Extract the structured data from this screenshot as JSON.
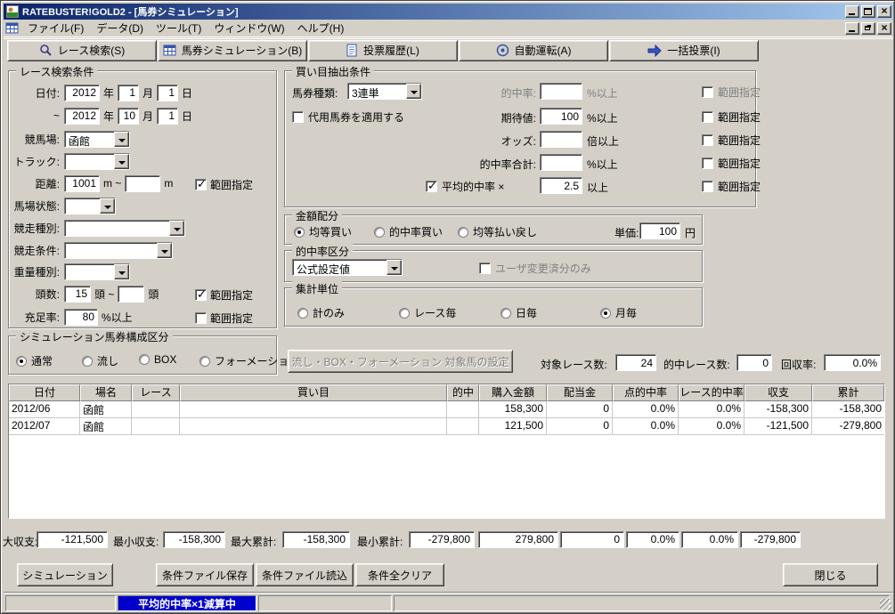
{
  "window": {
    "title": "RATEBUSTER!GOLD2 - [馬券シミュレーション]"
  },
  "menu": {
    "items": [
      "ファイル(F)",
      "データ(D)",
      "ツール(T)",
      "ウィンドウ(W)",
      "ヘルプ(H)"
    ]
  },
  "toolbar": {
    "buttons": [
      {
        "label": "レース検索(S)",
        "icon": "search-icon"
      },
      {
        "label": "馬券シミュレーション(B)",
        "icon": "grid-icon"
      },
      {
        "label": "投票履歴(L)",
        "icon": "document-icon"
      },
      {
        "label": "自動運転(A)",
        "icon": "auto-run-icon"
      },
      {
        "label": "一括投票(I)",
        "icon": "arrow-right-icon"
      }
    ]
  },
  "race_search": {
    "legend": "レース検索条件",
    "date_label": "日付:",
    "tilde": "~",
    "year_unit": "年",
    "month_unit": "月",
    "day_unit": "日",
    "from_year": "2012",
    "from_month": "1",
    "from_day": "1",
    "to_year": "2012",
    "to_month": "10",
    "to_day": "1",
    "course_label": "競馬場:",
    "course_value": "函館",
    "track_label": "トラック:",
    "track_value": "",
    "distance_label": "距離:",
    "distance_from": "1001",
    "distance_mid": "m ~",
    "distance_to": "",
    "distance_unit": "m",
    "range_label": "範囲指定",
    "distance_range_checked": true,
    "baba_label": "馬場状態:",
    "baba_value": "",
    "type_label": "競走種別:",
    "type_value": "",
    "cond_label": "競走条件:",
    "cond_value": "",
    "weight_label": "重量種別:",
    "weight_value": "",
    "heads_label": "頭数:",
    "heads_from": "15",
    "heads_mid": "頭 ~",
    "heads_to": "",
    "heads_unit": "頭",
    "heads_range_checked": true,
    "fill_label": "充足率:",
    "fill_value": "80",
    "fill_unit": "%以上",
    "fill_range_checked": false
  },
  "bet_extract": {
    "legend": "買い目抽出条件",
    "ticket_label": "馬券種類:",
    "ticket_value": "3連単",
    "substitute_label": "代用馬券を適用する",
    "substitute_checked": false,
    "range_label": "範囲指定",
    "hit_label": "的中率:",
    "hit_value": "",
    "hit_unit": "%以上",
    "hit_disabled": true,
    "expect_label": "期待値:",
    "expect_value": "100",
    "expect_unit": "%以上",
    "odds_label": "オッズ:",
    "odds_value": "",
    "odds_unit": "倍以上",
    "hit_total_label": "的中率合計:",
    "hit_total_value": "",
    "hit_total_unit": "%以上",
    "avg_label": "平均的中率 ×",
    "avg_value": "2.5",
    "avg_unit": "以上",
    "avg_checked": true
  },
  "amount": {
    "legend": "金額配分",
    "opt1": "均等買い",
    "opt2": "的中率買い",
    "opt3": "均等払い戻し",
    "selected_index": 0,
    "price_label": "単価:",
    "price_value": "100",
    "price_unit": "円"
  },
  "hit_class": {
    "legend": "的中率区分",
    "value": "公式設定値",
    "user_label": "ユーザ変更済分のみ",
    "user_checked": false
  },
  "aggregate": {
    "legend": "集計単位",
    "opt1": "計のみ",
    "opt2": "レース毎",
    "opt3": "日毎",
    "opt4": "月毎",
    "selected_index": 3
  },
  "sim_comp": {
    "legend": "シミュレーション馬券構成区分",
    "opt1": "通常",
    "opt2": "流し",
    "opt3": "BOX",
    "opt4": "フォーメーション",
    "selected_index": 0
  },
  "actions": {
    "target_setting": "流し・BOX・フォーメーション 対象馬の設定"
  },
  "stats": {
    "target_label": "対象レース数:",
    "target_value": "24",
    "hit_label": "的中レース数:",
    "hit_value": "0",
    "recovery_label": "回収率:",
    "recovery_value": "0.0%"
  },
  "table": {
    "headers": [
      "日付",
      "場名",
      "レース",
      "買い目",
      "的中",
      "購入金額",
      "配当金",
      "点的中率",
      "レース的中率",
      "収支",
      "累計"
    ],
    "rows": [
      [
        "2012/06",
        "函館",
        "",
        "",
        "",
        "158,300",
        "0",
        "0.0%",
        "0.0%",
        "-158,300",
        "-158,300"
      ],
      [
        "2012/07",
        "函館",
        "",
        "",
        "",
        "121,500",
        "0",
        "0.0%",
        "0.0%",
        "-121,500",
        "-279,800"
      ]
    ]
  },
  "summary": {
    "l1": "大収支:",
    "v1": "-121,500",
    "l2": "最小収支:",
    "v2": "-158,300",
    "l3": "最大累計:",
    "v3": "-158,300",
    "l4": "最小累計:",
    "v4": "-279,800",
    "t1": "279,800",
    "t2": "0",
    "t3": "0.0%",
    "t4": "0.0%",
    "t5": "-279,800"
  },
  "buttons": {
    "simulate": "シミュレーション",
    "save": "条件ファイル保存",
    "load": "条件ファイル読込",
    "clear": "条件全クリア",
    "close": "閉じる"
  },
  "statusbar": {
    "message": "平均的中率×1減算中"
  },
  "colors": {
    "titlebar_start": "#0a246a",
    "titlebar_end": "#a6caf0",
    "window_bg": "#d4d0c8",
    "status_badge": "#0000cc"
  }
}
